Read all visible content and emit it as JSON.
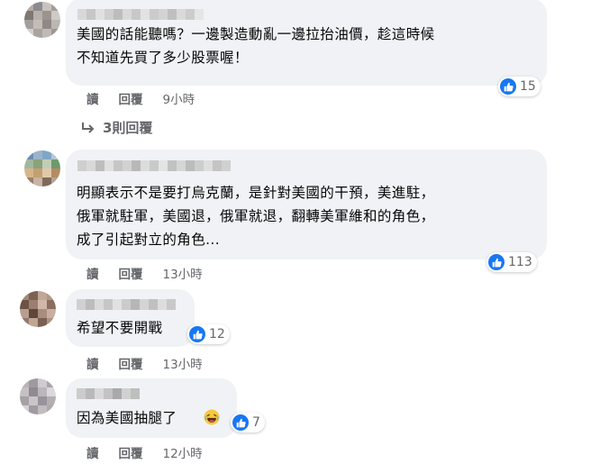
{
  "comments": [
    {
      "text": "美國的話能聽嗎？一邊製造動亂一邊拉抬油價，趁這時候\n不知道先買了多少股票喔！",
      "likes": "15",
      "actions": {
        "read": "讀",
        "reply": "回覆",
        "time": "9小時"
      },
      "replies_link": "3則回覆",
      "avatar_colors": [
        "#b5aaa2",
        "#8c8a91",
        "#c9c2bd",
        "#a59c96",
        "#7e7772",
        "#b8b0ab",
        "#9a948f",
        "#cfcac6",
        "#a39fa1",
        "#c4bcb6",
        "#8f8884",
        "#bdb7b2",
        "#d4cfcb",
        "#aaa4a0",
        "#c0bab6",
        "#9d9894"
      ],
      "name_colors": [
        "#d8d8d8",
        "#c7c7c7",
        "#e0e0e0",
        "#cfcfcf",
        "#bdbdbd",
        "#d9d9d9",
        "#c8c8c8",
        "#e2e2e2",
        "#cbcbcb",
        "#d3d3d3",
        "#bfbfbf",
        "#dadada",
        "#cccccc",
        "#e5e5e5"
      ]
    },
    {
      "text": "明顯表示不是要打烏克蘭，是針對美國的干預，美進駐，\n俄軍就駐軍，美國退，俄軍就退，翻轉美軍維和的角色，\n成了引起對立的角色...",
      "likes": "113",
      "actions": {
        "read": "讀",
        "reply": "回覆",
        "time": "13小時"
      },
      "avatar_colors": [
        "#6a8fb5",
        "#9bb3c9",
        "#7fa6c7",
        "#b9c7d3",
        "#a2b7a0",
        "#8aa37b",
        "#c2cdb8",
        "#6e9a6b",
        "#d7b58a",
        "#c49f72",
        "#e1c9a8",
        "#b48c62",
        "#9c7e6a",
        "#c9b3a3",
        "#7e6a5c",
        "#b7a293"
      ],
      "name_colors": [
        "#cfcfcf",
        "#d9d9d9",
        "#bdbdbd",
        "#e0e0e0",
        "#c6c6c6",
        "#d2d2d2",
        "#b8b8b8",
        "#dcdcdc",
        "#c9c9c9",
        "#e4e4e4",
        "#c2c2c2",
        "#d6d6d6",
        "#bcbcbc",
        "#cdcdcd",
        "#dedede",
        "#c4c4c4",
        "#d0d0d0"
      ]
    },
    {
      "text": "希望不要開戰",
      "likes": "12",
      "actions": {
        "read": "讀",
        "reply": "回覆",
        "time": "13小時"
      },
      "avatar_colors": [
        "#a08779",
        "#7c6154",
        "#c0a796",
        "#b49684",
        "#6e5246",
        "#9b7f70",
        "#d0b8a8",
        "#8a6e60",
        "#b79e8e",
        "#5f463b",
        "#a98d7d",
        "#c8af9f",
        "#93786a",
        "#bea594",
        "#7a5f52",
        "#ad9383"
      ],
      "name_colors": [
        "#d0d0d0",
        "#bcbcbc",
        "#dadada",
        "#c6c6c6",
        "#e1e1e1",
        "#cbcbcb",
        "#b6b6b6",
        "#d4d4d4",
        "#c0c0c0",
        "#dddddd",
        "#c8c8c8"
      ]
    },
    {
      "text": "因為美國抽腿了",
      "likes": "7",
      "actions": {
        "read": "讀",
        "reply": "回覆",
        "time": "12小時"
      },
      "avatar_colors": [
        "#b9b4b8",
        "#9f9a9f",
        "#d0cbcf",
        "#aaa5aa",
        "#c5c0c4",
        "#8f8a8f",
        "#bbb6ba",
        "#dcd8db",
        "#a6a1a5",
        "#cac5c9",
        "#98939a",
        "#b3aeb2",
        "#d6d1d5",
        "#a09ba0",
        "#c1bcc0",
        "#aea9ad"
      ],
      "name_colors": [
        "#cccccc",
        "#b9b9b9",
        "#d9d9d9",
        "#c3c3c3",
        "#a9a9a9",
        "#d1d1d1",
        "#bebebe"
      ]
    }
  ]
}
